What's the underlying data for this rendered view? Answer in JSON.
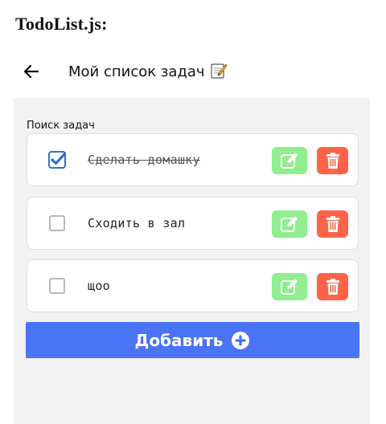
{
  "file_title": "TodoList.js:",
  "header": {
    "title": "Мой список задач",
    "back_icon": "arrow-left-icon",
    "title_icon": "memo-icon"
  },
  "search": {
    "label": "Поиск задач"
  },
  "tasks": [
    {
      "text": "Сделать домашку",
      "done": true
    },
    {
      "text": "Сходить в зал",
      "done": false
    },
    {
      "text": "щоо",
      "done": false
    }
  ],
  "actions": {
    "edit_icon": "edit-icon",
    "delete_icon": "trash-icon"
  },
  "add_button": {
    "label": "Добавить",
    "icon": "plus-circle-icon"
  },
  "colors": {
    "panel_bg": "#f2f2f2",
    "edit_bg": "#90ee90",
    "delete_bg": "#ff6347",
    "add_bg": "#4a74f5",
    "checkbox_checked": "#2f6fd6"
  }
}
